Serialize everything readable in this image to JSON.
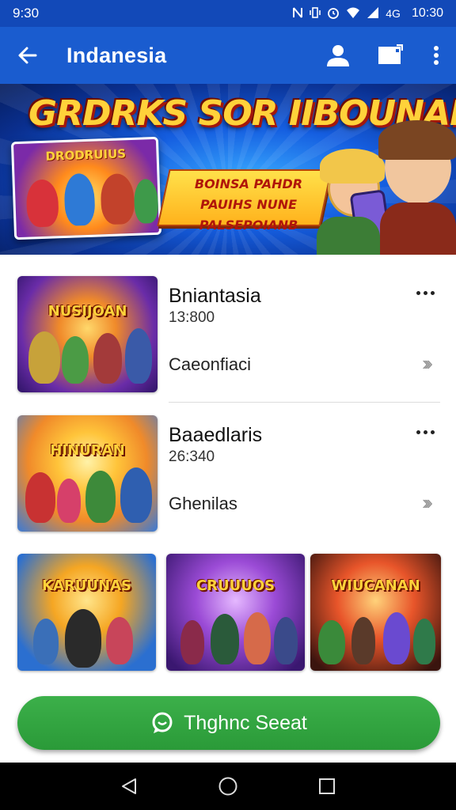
{
  "status_bar": {
    "left_time": "9:30",
    "icons": [
      "nfc-icon",
      "vibrate-icon",
      "alarm-icon",
      "wifi-icon",
      "signal-icon"
    ],
    "network": "4G",
    "right_time": "10:30"
  },
  "app_bar": {
    "title": "Indanesia",
    "icons": [
      "back-arrow-icon",
      "profile-icon",
      "window-icon",
      "more-vert-icon"
    ],
    "background": "#1a5ccf"
  },
  "banner": {
    "headline": "GRDRKS SOR IIBOUNAN",
    "card_title": "DRODRUIUS",
    "tagline": "BOINSA PAHDR PAUIHS NUNE PALSEPOIANB"
  },
  "list": {
    "items": [
      {
        "thumb_title": "NUSIJOAN",
        "title": "Bniantasia",
        "subtitle": "13:800",
        "meta": "Caeonfiaci"
      },
      {
        "thumb_title": "HINURAN",
        "title": "Baaedlaris",
        "subtitle": "26:340",
        "meta": "Ghenilas"
      }
    ],
    "menu_icon": "more-horiz-icon",
    "chevron_icon": "double-chevron-right-icon"
  },
  "grid": {
    "tiles": [
      {
        "title": "KARUUNAS"
      },
      {
        "title": "CRUUUOS"
      },
      {
        "title": "WIUCANAN"
      }
    ]
  },
  "cta": {
    "label": "Thghnc Seeat",
    "icon": "chat-bubble-icon",
    "color": "#2fa53f"
  },
  "nav_bar": {
    "icons": [
      "back-triangle-icon",
      "home-circle-icon",
      "recents-square-icon"
    ]
  }
}
